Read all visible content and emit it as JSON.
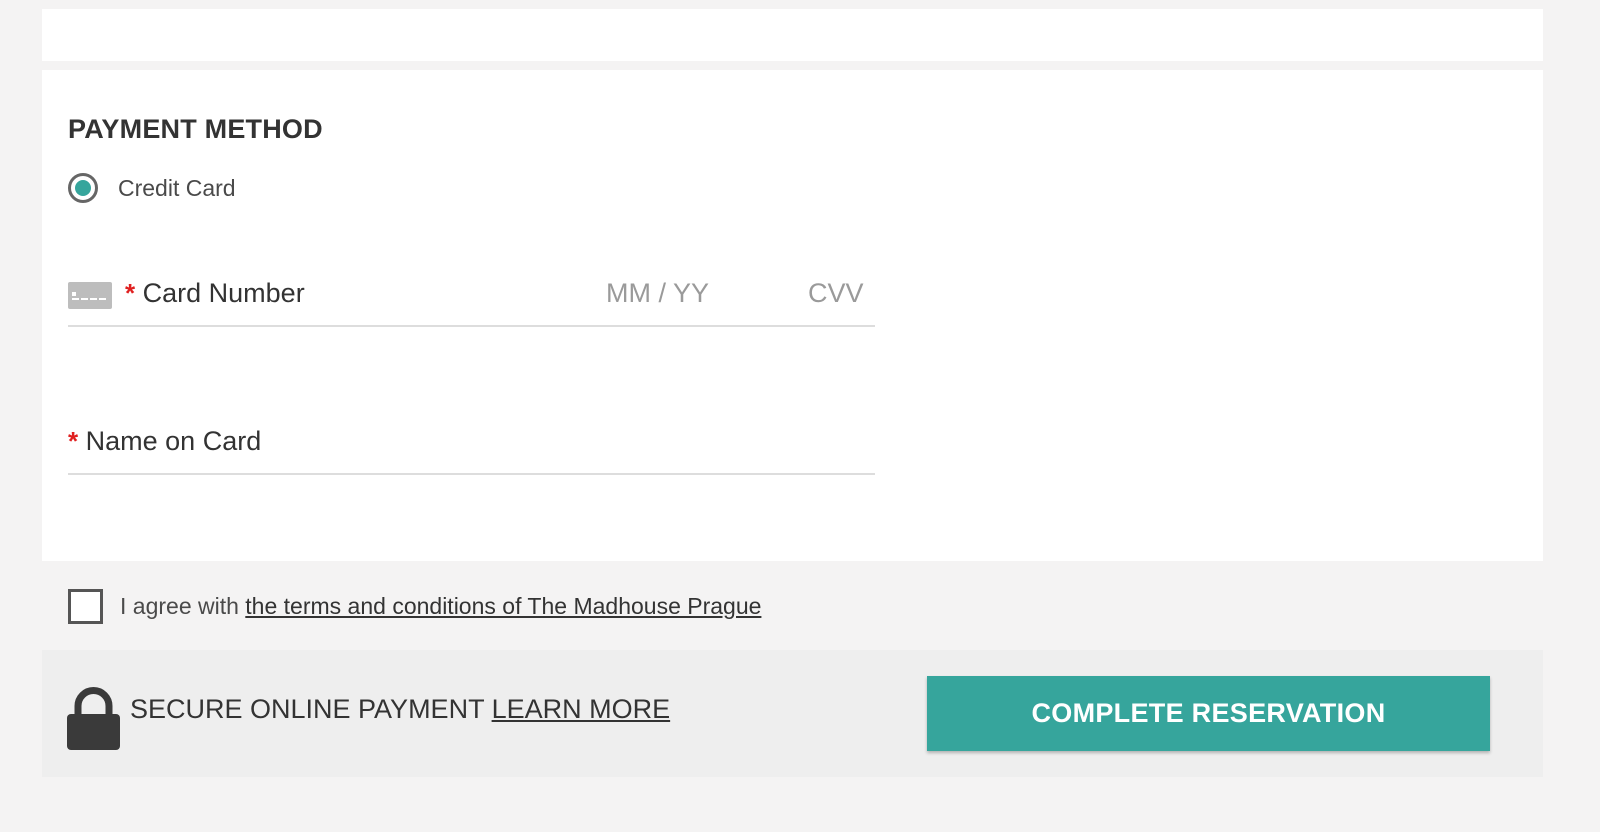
{
  "payment": {
    "title": "PAYMENT METHOD",
    "method_option": "Credit Card",
    "method_selected": true,
    "required_marker": "*",
    "card_number_label": "Card Number",
    "expiry_placeholder": "MM / YY",
    "cvv_placeholder": "CVV",
    "name_label": "Name on Card"
  },
  "agreement": {
    "prefix": "I agree with ",
    "link_text": "the terms and conditions of The Madhouse Prague",
    "checked": false
  },
  "footer": {
    "secure_text": "SECURE ONLINE PAYMENT",
    "learn_more": "LEARN MORE",
    "complete_button": "COMPLETE RESERVATION"
  },
  "icons": {
    "card": "credit-card-icon",
    "lock": "lock-icon"
  },
  "colors": {
    "accent": "#36a59c",
    "required": "#e02020",
    "page_background": "#f4f3f3",
    "footer_background": "#eeeeee"
  }
}
